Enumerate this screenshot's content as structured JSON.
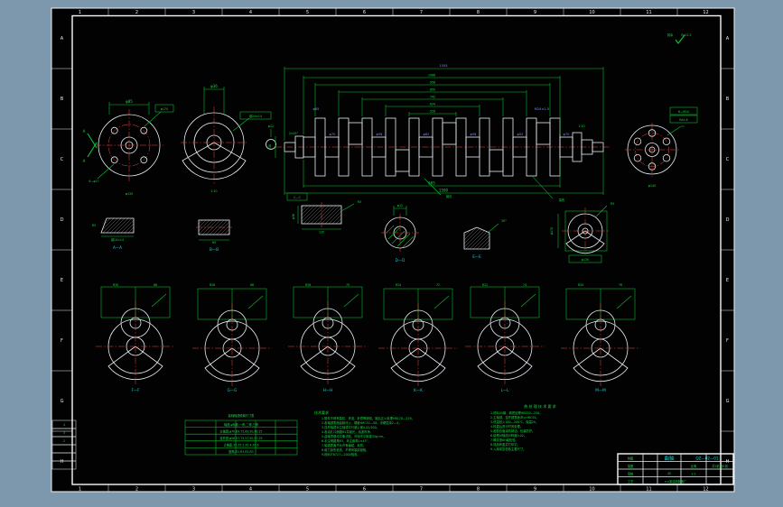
{
  "colors": {
    "page_bg": "#7d97ac",
    "sheet_bg": "#020202",
    "frame": "#eef2f6",
    "dimension_green": "#0ac832",
    "text_blue": "#7b8dff",
    "text_cyan": "#19cfd4",
    "centerline_red": "#f5463c"
  },
  "zones": {
    "top": [
      "1",
      "2",
      "3",
      "4",
      "5",
      "6",
      "7",
      "8",
      "9",
      "10",
      "11",
      "12"
    ],
    "bottom": [
      "1",
      "2",
      "3",
      "4",
      "5",
      "6",
      "7",
      "8",
      "9",
      "10",
      "11",
      "12"
    ],
    "left": [
      "A",
      "B",
      "C",
      "D",
      "E",
      "F",
      "G",
      "H"
    ],
    "right": [
      "A",
      "B",
      "C",
      "D",
      "E",
      "F",
      "G",
      "H"
    ]
  },
  "d": [
    "1555",
    "1066",
    "958",
    "850",
    "742",
    "634",
    "526",
    "1590",
    "φ70",
    "φ58",
    "φ62",
    "φ52",
    "φ85",
    "M24×1.5",
    "1:10",
    "2×45°",
    "φ170",
    "φ130",
    "6—φ17",
    "A",
    "A—A",
    "B—B",
    "键24×14",
    "R5",
    "Ra1.6",
    "6—M10",
    "φ140",
    "Ra12.5",
    "65",
    "665",
    "R3",
    "探伤",
    "抛光",
    "C—C",
    "φ36",
    "30°",
    "φ24",
    "φ12",
    "1:10",
    "120",
    "D—D",
    "E—E",
    "其余"
  ],
  "sec": [
    "F—F",
    "G—G",
    "H—H",
    "K—K",
    "L—L",
    "M—M"
  ],
  "webdims": [
    "R30",
    "66",
    "R28",
    "68",
    "R26",
    "70",
    "R24",
    "72",
    "R22",
    "74",
    "R20",
    "76"
  ],
  "notes": {
    "left_title": "曲轴轴颈修磨尺寸表",
    "table_headers": [
      "轴颈",
      "φ标准",
      "一修",
      "二修",
      "三修"
    ],
    "table_rows": [
      [
        "主轴颈",
        "φ70",
        "69.75",
        "69.50",
        "69.25"
      ],
      [
        "连杆颈",
        "φ58",
        "57.75",
        "57.50",
        "57.25"
      ],
      [
        "止推面",
        "35",
        "35.2",
        "35.4",
        "35.6"
      ],
      [
        "圆角",
        "R3",
        "R3",
        "R3",
        "R3"
      ]
    ],
    "minis": [
      "4",
      "3",
      "2"
    ],
    "center": [
      "技术要求",
      "1.锻件不得有裂纹、夹渣、折叠等缺陷，锻后正火处理HB170—229。",
      "2.各轴颈表面高频淬火，硬度HRC52—58，淬硬层深2—4。",
      "3.连杆轴颈对主轴颈平行度公差0.02/100。",
      "4.各油孔口倒圆R2并抛光，油道吹净。",
      "5.曲轴须做动平衡试验，许用不平衡量35g·cm。",
      "6.未注明圆角R3，未注倒角1×45°。",
      "7.轴颈表面不允许有磕碰、划伤。",
      "8.磁力探伤检查，不得有裂纹缺陷。",
      "9.按JB/T6727—2000验收。"
    ],
    "right_title": "热 处 理 技 术 要 求",
    "right": [
      "1.材料45钢，调质处理HB220—250。",
      "2.主轴颈、连杆颈表面淬火HRC55。",
      "3.低温回火180—200℃，保温2h。",
      "4.校直后进行时效处理。",
      "5.各配合面涂防锈油，包装防护。",
      "6.键槽对轴线对称度0.02。",
      "7.螺纹按6H级检验。",
      "8.成品称重并打印记。",
      "9.入库前复检各主要尺寸。"
    ]
  },
  "titleblock": {
    "roles": [
      "制图",
      "描图",
      "审核",
      "工艺"
    ],
    "name": "曲轴",
    "number": "QZ—02—01",
    "material": "45",
    "scale_label": "比例",
    "scale": "1:2",
    "sheet": "共1张 第1张",
    "company": "××柴油机制造厂"
  }
}
